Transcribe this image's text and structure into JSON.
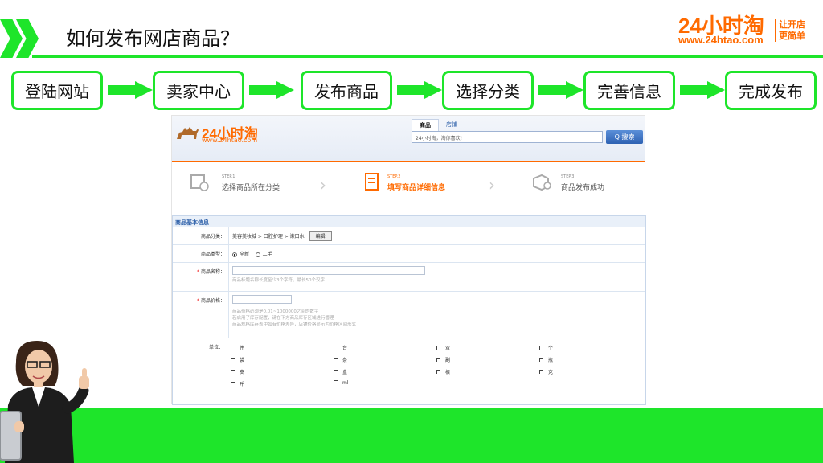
{
  "header": {
    "title": "如何发布网店商品？",
    "brand": {
      "name": "24小时淘",
      "url": "www.24htao.com",
      "slogan_line1": "让开店",
      "slogan_line2": "更简单"
    }
  },
  "flow": {
    "steps": [
      "登陆网站",
      "卖家中心",
      "发布商品",
      "选择分类",
      "完善信息",
      "完成发布"
    ]
  },
  "screenshot": {
    "logo": {
      "name": "24小时淘",
      "url": "www.24htao.com"
    },
    "tabs": [
      "商品",
      "店铺"
    ],
    "search_placeholder": "24小时淘，淘你喜欢!",
    "search_button": "Q 搜索",
    "steps": [
      {
        "step": "STEP.1",
        "name": "选择商品所在分类"
      },
      {
        "step": "STEP.2",
        "name": "填写商品详细信息"
      },
      {
        "step": "STEP.3",
        "name": "商品发布成功"
      }
    ],
    "form": {
      "section_title": "商品基本信息",
      "category_label": "商品分类：",
      "category_path": "美容美妆城 > 口腔护理 > 漱口水",
      "edit_button": "编辑",
      "type_label": "商品类型：",
      "type_options": [
        "全新",
        "二手"
      ],
      "name_label": "商品名称：",
      "name_hint": "商品标题名称长度至少3个字符，最长50个汉字",
      "price_label": "商品价格：",
      "price_hints": [
        "商品价格必须是0.01~1000000之间的数字",
        "若启用了库存配置，请在下方商品库存区域进行管理",
        "商品规格库存表中如有价格差异，店铺价格显示为价格区间形式"
      ],
      "unit_label": "单位：",
      "units": [
        "件",
        "台",
        "双",
        "个",
        "袋",
        "条",
        "副",
        "瓶",
        "支",
        "盒",
        "根",
        "克",
        "斤",
        "ml"
      ]
    }
  },
  "colors": {
    "accent_green": "#1ee52a",
    "brand_orange": "#ff6a00",
    "link_blue": "#2b5ea8"
  }
}
